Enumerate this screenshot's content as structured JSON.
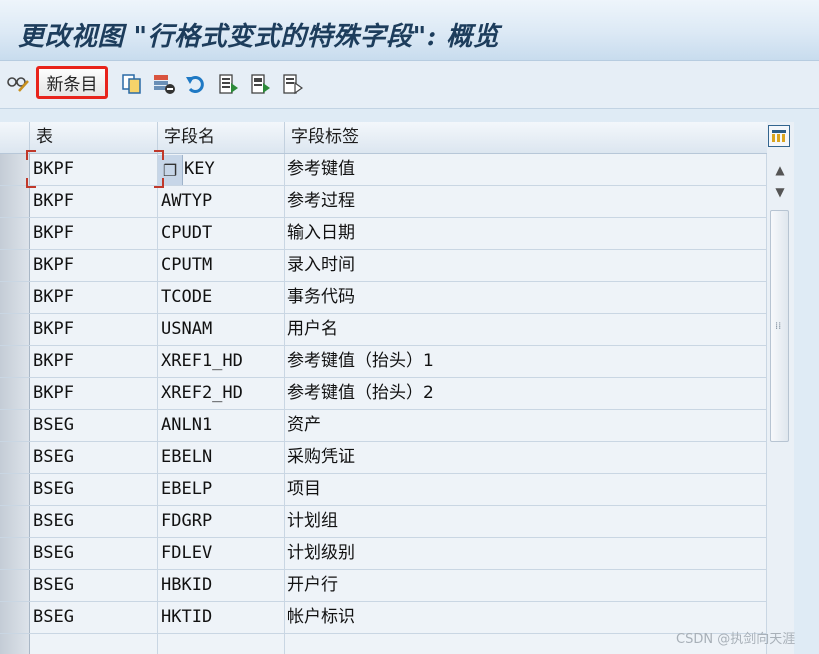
{
  "title": "更改视图 \"行格式变式的特殊字段\": 概览",
  "toolbar": {
    "new_entries_label": "新条目",
    "icons": [
      "glasses-pencil-icon",
      "copy-icon",
      "delete-icon",
      "undo-icon",
      "select-all-icon",
      "select-block-icon",
      "deselect-all-icon"
    ]
  },
  "table": {
    "headers": [
      "表",
      "字段名",
      "字段标签"
    ],
    "rows": [
      [
        "BKPF",
        "KEY",
        "参考键值"
      ],
      [
        "BKPF",
        "AWTYP",
        "参考过程"
      ],
      [
        "BKPF",
        "CPUDT",
        "输入日期"
      ],
      [
        "BKPF",
        "CPUTM",
        "录入时间"
      ],
      [
        "BKPF",
        "TCODE",
        "事务代码"
      ],
      [
        "BKPF",
        "USNAM",
        "用户名"
      ],
      [
        "BKPF",
        "XREF1_HD",
        "参考键值（抬头）1"
      ],
      [
        "BKPF",
        "XREF2_HD",
        "参考键值（抬头）2"
      ],
      [
        "BSEG",
        "ANLN1",
        "资产"
      ],
      [
        "BSEG",
        "EBELN",
        "采购凭证"
      ],
      [
        "BSEG",
        "EBELP",
        "项目"
      ],
      [
        "BSEG",
        "FDGRP",
        "计划组"
      ],
      [
        "BSEG",
        "FDLEV",
        "计划级别"
      ],
      [
        "BSEG",
        "HBKID",
        "开户行"
      ],
      [
        "BSEG",
        "HKTID",
        "帐户标识"
      ],
      [
        "",
        "",
        ""
      ]
    ]
  },
  "watermark": "CSDN @执剑向天涯"
}
